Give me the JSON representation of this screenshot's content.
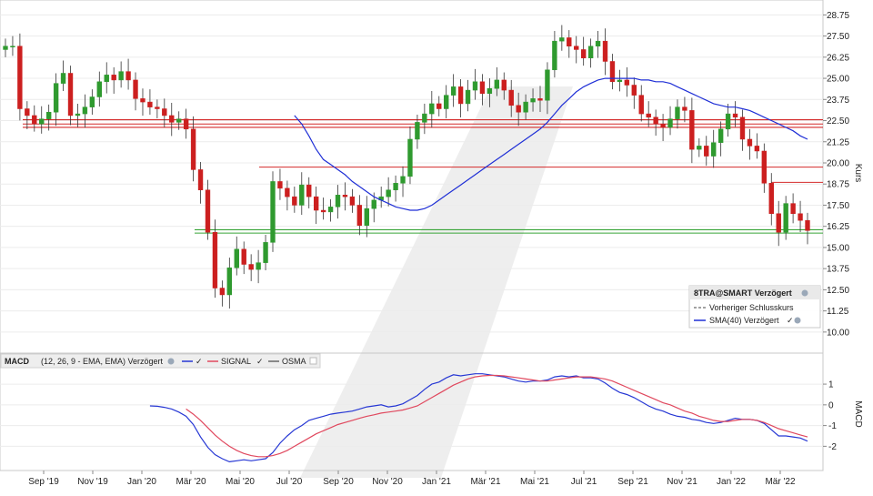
{
  "chart_data": [
    {
      "type": "candlestick",
      "title": "8TRA@SMART Verzögert",
      "ylabel": "Kurs",
      "y_ticks": [
        "28.75",
        "27.50",
        "26.25",
        "25.00",
        "23.75",
        "22.50",
        "21.25",
        "20.00",
        "18.75",
        "17.50",
        "16.25",
        "15.00",
        "13.75",
        "12.50",
        "11.25",
        "10.00"
      ],
      "ylim": [
        9.4,
        29.2
      ],
      "x_labels": [
        "Sep '19",
        "Nov '19",
        "Jan '20",
        "Mär '20",
        "Mai '20",
        "Jul '20",
        "Sep '20",
        "Nov '20",
        "Jan '21",
        "Mär '21",
        "Mai '21",
        "Jul '21",
        "Sep '21",
        "Nov '21",
        "Jan '22",
        "Mär '22"
      ],
      "legend": [
        {
          "label": "8TRA@SMART Verzögert",
          "icon": "globe-icon"
        },
        {
          "label": "Vorheriger Schlusskurs",
          "icon": "dashed-line-icon"
        },
        {
          "label": "SMA(40) Verzögert",
          "icon": "check-globe-icon"
        }
      ],
      "close": [
        26.9,
        26.9,
        23.2,
        22.8,
        22.3,
        22.6,
        23.0,
        24.7,
        25.3,
        22.8,
        22.9,
        23.3,
        23.9,
        24.8,
        25.2,
        24.9,
        25.4,
        24.9,
        23.8,
        23.6,
        23.3,
        23.2,
        22.8,
        22.4,
        22.6,
        22.0,
        19.6,
        18.4,
        15.9,
        12.6,
        12.2,
        13.8,
        14.9,
        14.0,
        13.7,
        14.1,
        15.3,
        18.9,
        18.5,
        18.0,
        17.5,
        18.7,
        18.0,
        17.2,
        17.1,
        17.4,
        18.1,
        18.0,
        17.5,
        16.3,
        17.3,
        17.8,
        18.0,
        18.4,
        18.8,
        19.2,
        21.4,
        22.4,
        22.9,
        23.5,
        23.2,
        24.0,
        24.5,
        23.5,
        24.3,
        24.8,
        24.1,
        24.4,
        24.9,
        24.3,
        23.4,
        23.0,
        23.6,
        23.8,
        23.7,
        25.5,
        27.2,
        27.4,
        26.9,
        26.7,
        26.2,
        26.9,
        27.2,
        26.0,
        24.8,
        24.9,
        24.6,
        24.0,
        22.9,
        22.7,
        22.3,
        22.1,
        22.6,
        23.3,
        23.1,
        20.8,
        21.0,
        20.4,
        21.2,
        22.0,
        22.9,
        22.7,
        21.4,
        21.0,
        20.7,
        18.8,
        17.0,
        15.9,
        17.6,
        17.0,
        16.6,
        16.0
      ],
      "series": [
        {
          "name": "SMA(40) Verzögert",
          "color": "#1f2fd6",
          "values": [
            null,
            null,
            null,
            null,
            null,
            null,
            null,
            null,
            null,
            null,
            null,
            null,
            null,
            null,
            null,
            null,
            null,
            null,
            null,
            null,
            null,
            null,
            null,
            null,
            null,
            null,
            null,
            null,
            null,
            null,
            null,
            null,
            null,
            null,
            null,
            null,
            null,
            null,
            null,
            null,
            22.8,
            22.3,
            21.6,
            20.8,
            20.2,
            19.9,
            19.6,
            19.3,
            18.9,
            18.6,
            18.3,
            18.0,
            17.8,
            17.6,
            17.4,
            17.3,
            17.2,
            17.2,
            17.3,
            17.5,
            17.8,
            18.1,
            18.4,
            18.7,
            19.0,
            19.3,
            19.6,
            19.9,
            20.2,
            20.5,
            20.8,
            21.1,
            21.4,
            21.7,
            22.0,
            22.4,
            22.9,
            23.4,
            23.8,
            24.2,
            24.5,
            24.7,
            24.9,
            25.0,
            25.0,
            25.0,
            25.0,
            25.0,
            24.9,
            24.9,
            24.8,
            24.8,
            24.7,
            24.5,
            24.3,
            24.1,
            23.9,
            23.7,
            23.5,
            23.4,
            23.3,
            23.3,
            23.2,
            23.1,
            22.9,
            22.7,
            22.5,
            22.3,
            22.1,
            21.9,
            21.6,
            21.4
          ]
        }
      ],
      "horizontal_lines": [
        {
          "value": 22.55,
          "color": "#d42a2a"
        },
        {
          "value": 22.3,
          "color": "#d42a2a"
        },
        {
          "value": 22.1,
          "color": "#d42a2a"
        },
        {
          "value": 19.75,
          "color": "#d42a2a"
        },
        {
          "value": 18.85,
          "color": "#d42a2a"
        },
        {
          "value": 16.05,
          "color": "#37a437"
        },
        {
          "value": 15.85,
          "color": "#37a437"
        }
      ]
    },
    {
      "type": "line",
      "title": "MACD",
      "subtitle": "(12, 26, 9 - EMA, EMA) Verzögert",
      "ylabel": "MACD",
      "y_ticks": [
        "1",
        "0",
        "-1",
        "-2"
      ],
      "ylim": [
        -2.95,
        1.75
      ],
      "legend": [
        {
          "label": "",
          "color": "#2637d4"
        },
        {
          "label": "SIGNAL",
          "color": "#e0485e"
        },
        {
          "label": "OSMA",
          "color": "#666666"
        }
      ],
      "series": [
        {
          "name": "",
          "color": "#2637d4",
          "values": [
            null,
            null,
            null,
            null,
            null,
            null,
            null,
            null,
            null,
            null,
            null,
            null,
            null,
            null,
            null,
            null,
            null,
            null,
            null,
            null,
            -0.05,
            -0.07,
            -0.12,
            -0.2,
            -0.35,
            -0.55,
            -0.95,
            -1.55,
            -2.05,
            -2.4,
            -2.6,
            -2.75,
            -2.7,
            -2.65,
            -2.7,
            -2.65,
            -2.6,
            -2.3,
            -1.85,
            -1.5,
            -1.2,
            -1.0,
            -0.75,
            -0.65,
            -0.55,
            -0.45,
            -0.4,
            -0.35,
            -0.3,
            -0.2,
            -0.1,
            -0.05,
            0.0,
            -0.1,
            -0.05,
            0.05,
            0.25,
            0.45,
            0.75,
            1.0,
            1.1,
            1.3,
            1.45,
            1.4,
            1.45,
            1.5,
            1.5,
            1.45,
            1.4,
            1.35,
            1.25,
            1.15,
            1.1,
            1.15,
            1.15,
            1.2,
            1.35,
            1.4,
            1.35,
            1.4,
            1.3,
            1.3,
            1.25,
            1.05,
            0.8,
            0.6,
            0.5,
            0.35,
            0.15,
            -0.05,
            -0.2,
            -0.3,
            -0.45,
            -0.55,
            -0.6,
            -0.7,
            -0.75,
            -0.85,
            -0.9,
            -0.85,
            -0.75,
            -0.65,
            -0.7,
            -0.7,
            -0.75,
            -0.9,
            -1.2,
            -1.5,
            -1.5,
            -1.55,
            -1.6,
            -1.75
          ]
        },
        {
          "name": "SIGNAL",
          "color": "#e0485e",
          "values": [
            null,
            null,
            null,
            null,
            null,
            null,
            null,
            null,
            null,
            null,
            null,
            null,
            null,
            null,
            null,
            null,
            null,
            null,
            null,
            null,
            null,
            null,
            null,
            null,
            null,
            -0.2,
            -0.45,
            -0.75,
            -1.1,
            -1.45,
            -1.75,
            -2.0,
            -2.2,
            -2.35,
            -2.45,
            -2.5,
            -2.5,
            -2.45,
            -2.35,
            -2.2,
            -2.0,
            -1.8,
            -1.6,
            -1.4,
            -1.25,
            -1.1,
            -0.95,
            -0.85,
            -0.75,
            -0.65,
            -0.55,
            -0.48,
            -0.4,
            -0.35,
            -0.3,
            -0.25,
            -0.15,
            -0.05,
            0.15,
            0.35,
            0.55,
            0.75,
            0.95,
            1.1,
            1.25,
            1.35,
            1.4,
            1.42,
            1.42,
            1.4,
            1.35,
            1.3,
            1.25,
            1.2,
            1.15,
            1.15,
            1.2,
            1.25,
            1.3,
            1.35,
            1.35,
            1.35,
            1.3,
            1.25,
            1.15,
            1.0,
            0.85,
            0.7,
            0.55,
            0.4,
            0.25,
            0.1,
            0.0,
            -0.15,
            -0.3,
            -0.4,
            -0.55,
            -0.65,
            -0.75,
            -0.8,
            -0.8,
            -0.75,
            -0.7,
            -0.7,
            -0.75,
            -0.85,
            -1.0,
            -1.15,
            -1.25,
            -1.35,
            -1.45,
            -1.55
          ]
        }
      ]
    }
  ]
}
